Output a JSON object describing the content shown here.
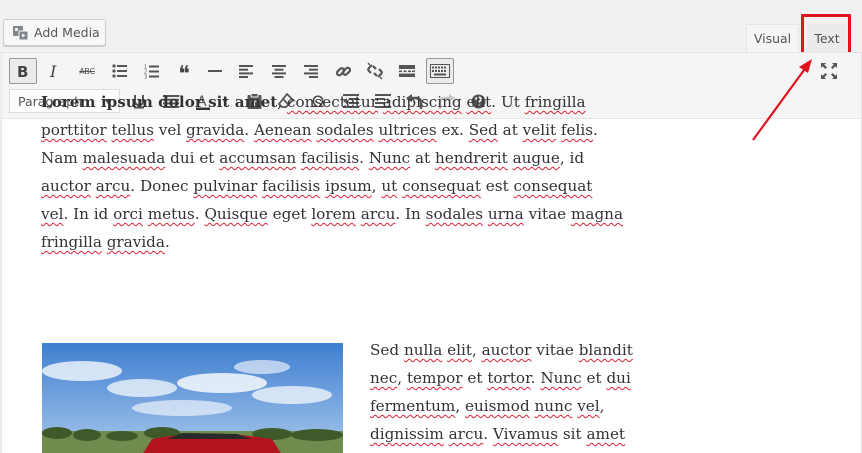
{
  "header": {
    "add_media_label": "Add Media",
    "tabs": [
      {
        "label": "Visual",
        "active": true
      },
      {
        "label": "Text",
        "active": false
      }
    ]
  },
  "toolbar": {
    "row1": [
      "bold-icon",
      "italic-icon",
      "strikethrough-icon",
      "bullet-list-icon",
      "numbered-list-icon",
      "blockquote-icon",
      "horizontal-rule-icon",
      "align-left-icon",
      "align-center-icon",
      "align-right-icon",
      "link-icon",
      "unlink-icon",
      "read-more-icon",
      "toolbar-toggle-icon",
      "fullscreen-icon"
    ],
    "row2": [
      "underline-icon",
      "justify-icon",
      "text-color-icon",
      "paste-text-icon",
      "clear-formatting-icon",
      "special-character-icon",
      "outdent-icon",
      "indent-icon",
      "undo-icon",
      "redo-icon",
      "help-icon"
    ],
    "format_value": "Paragraph",
    "abc_glyph": "ABC",
    "omega_glyph": "Ω",
    "quote_glyph": "❝"
  },
  "content": {
    "para1_lines": [
      [
        {
          "t": "Lorem ipsum dolor sit amet",
          "b": true
        },
        {
          "t": ", "
        },
        {
          "t": "consectetur",
          "m": true
        },
        {
          "t": " "
        },
        {
          "t": "adipiscing",
          "m": true
        },
        {
          "t": " "
        },
        {
          "t": "elit",
          "m": true
        },
        {
          "t": ". Ut "
        },
        {
          "t": "fringilla",
          "m": true
        }
      ],
      [
        {
          "t": "porttitor",
          "m": true
        },
        {
          "t": " "
        },
        {
          "t": "tellus",
          "m": true
        },
        {
          "t": " vel "
        },
        {
          "t": "gravida",
          "m": true
        },
        {
          "t": ". "
        },
        {
          "t": "Aenean",
          "m": true
        },
        {
          "t": " "
        },
        {
          "t": "sodales",
          "m": true
        },
        {
          "t": " "
        },
        {
          "t": "ultrices",
          "m": true
        },
        {
          "t": " ex. "
        },
        {
          "t": "Sed",
          "m": true
        },
        {
          "t": " at "
        },
        {
          "t": "velit",
          "m": true
        },
        {
          "t": " "
        },
        {
          "t": "felis",
          "m": true
        },
        {
          "t": "."
        }
      ],
      [
        {
          "t": "Nam "
        },
        {
          "t": "malesuada",
          "m": true
        },
        {
          "t": " dui et "
        },
        {
          "t": "accumsan",
          "m": true
        },
        {
          "t": " "
        },
        {
          "t": "facilisis",
          "m": true
        },
        {
          "t": ". "
        },
        {
          "t": "Nunc",
          "m": true
        },
        {
          "t": " at "
        },
        {
          "t": "hendrerit",
          "m": true
        },
        {
          "t": " "
        },
        {
          "t": "augue",
          "m": true
        },
        {
          "t": ", id"
        }
      ],
      [
        {
          "t": "auctor",
          "m": true
        },
        {
          "t": " "
        },
        {
          "t": "arcu",
          "m": true
        },
        {
          "t": ". Donec "
        },
        {
          "t": "pulvinar",
          "m": true
        },
        {
          "t": " "
        },
        {
          "t": "facilisis",
          "m": true
        },
        {
          "t": " "
        },
        {
          "t": "ipsum",
          "m": true
        },
        {
          "t": ", "
        },
        {
          "t": "ut",
          "m": true
        },
        {
          "t": " "
        },
        {
          "t": "consequat",
          "m": true
        },
        {
          "t": " est "
        },
        {
          "t": "consequat",
          "m": true
        }
      ],
      [
        {
          "t": "vel",
          "m": true
        },
        {
          "t": ". In id "
        },
        {
          "t": "orci",
          "m": true
        },
        {
          "t": " "
        },
        {
          "t": "metus",
          "m": true
        },
        {
          "t": ". "
        },
        {
          "t": "Quisque",
          "m": true
        },
        {
          "t": " eget "
        },
        {
          "t": "lorem",
          "m": true
        },
        {
          "t": " "
        },
        {
          "t": "arcu",
          "m": true
        },
        {
          "t": ". In "
        },
        {
          "t": "sodales",
          "m": true
        },
        {
          "t": " "
        },
        {
          "t": "urna",
          "m": true
        },
        {
          "t": " vitae "
        },
        {
          "t": "magna",
          "m": true
        }
      ],
      [
        {
          "t": "fringilla",
          "m": true
        },
        {
          "t": " "
        },
        {
          "t": "gravida",
          "m": true
        },
        {
          "t": "."
        }
      ]
    ],
    "side_lines": [
      [
        {
          "t": "Sed "
        },
        {
          "t": "nulla",
          "m": true
        },
        {
          "t": " "
        },
        {
          "t": "elit",
          "m": true
        },
        {
          "t": ", "
        },
        {
          "t": "auctor",
          "m": true
        },
        {
          "t": " vitae "
        },
        {
          "t": "blandit",
          "m": true
        }
      ],
      [
        {
          "t": "nec",
          "m": true
        },
        {
          "t": ", "
        },
        {
          "t": "tempor",
          "m": true
        },
        {
          "t": " et "
        },
        {
          "t": "tortor",
          "m": true
        },
        {
          "t": ". "
        },
        {
          "t": "Nunc",
          "m": true
        },
        {
          "t": " et "
        },
        {
          "t": "dui",
          "m": true
        }
      ],
      [
        {
          "t": "fermentum",
          "m": true
        },
        {
          "t": ", "
        },
        {
          "t": "euismod",
          "m": true
        },
        {
          "t": " "
        },
        {
          "t": "nunc",
          "m": true
        },
        {
          "t": " "
        },
        {
          "t": "vel",
          "m": true
        },
        {
          "t": ","
        }
      ],
      [
        {
          "t": "dignissim",
          "m": true
        },
        {
          "t": " "
        },
        {
          "t": "arcu",
          "m": true
        },
        {
          "t": ". "
        },
        {
          "t": "Vivamus",
          "m": true
        },
        {
          "t": " sit "
        },
        {
          "t": "amet",
          "m": true
        }
      ]
    ]
  },
  "colors": {
    "highlight": "#e0141f",
    "spellcheck": "#e1223a"
  }
}
